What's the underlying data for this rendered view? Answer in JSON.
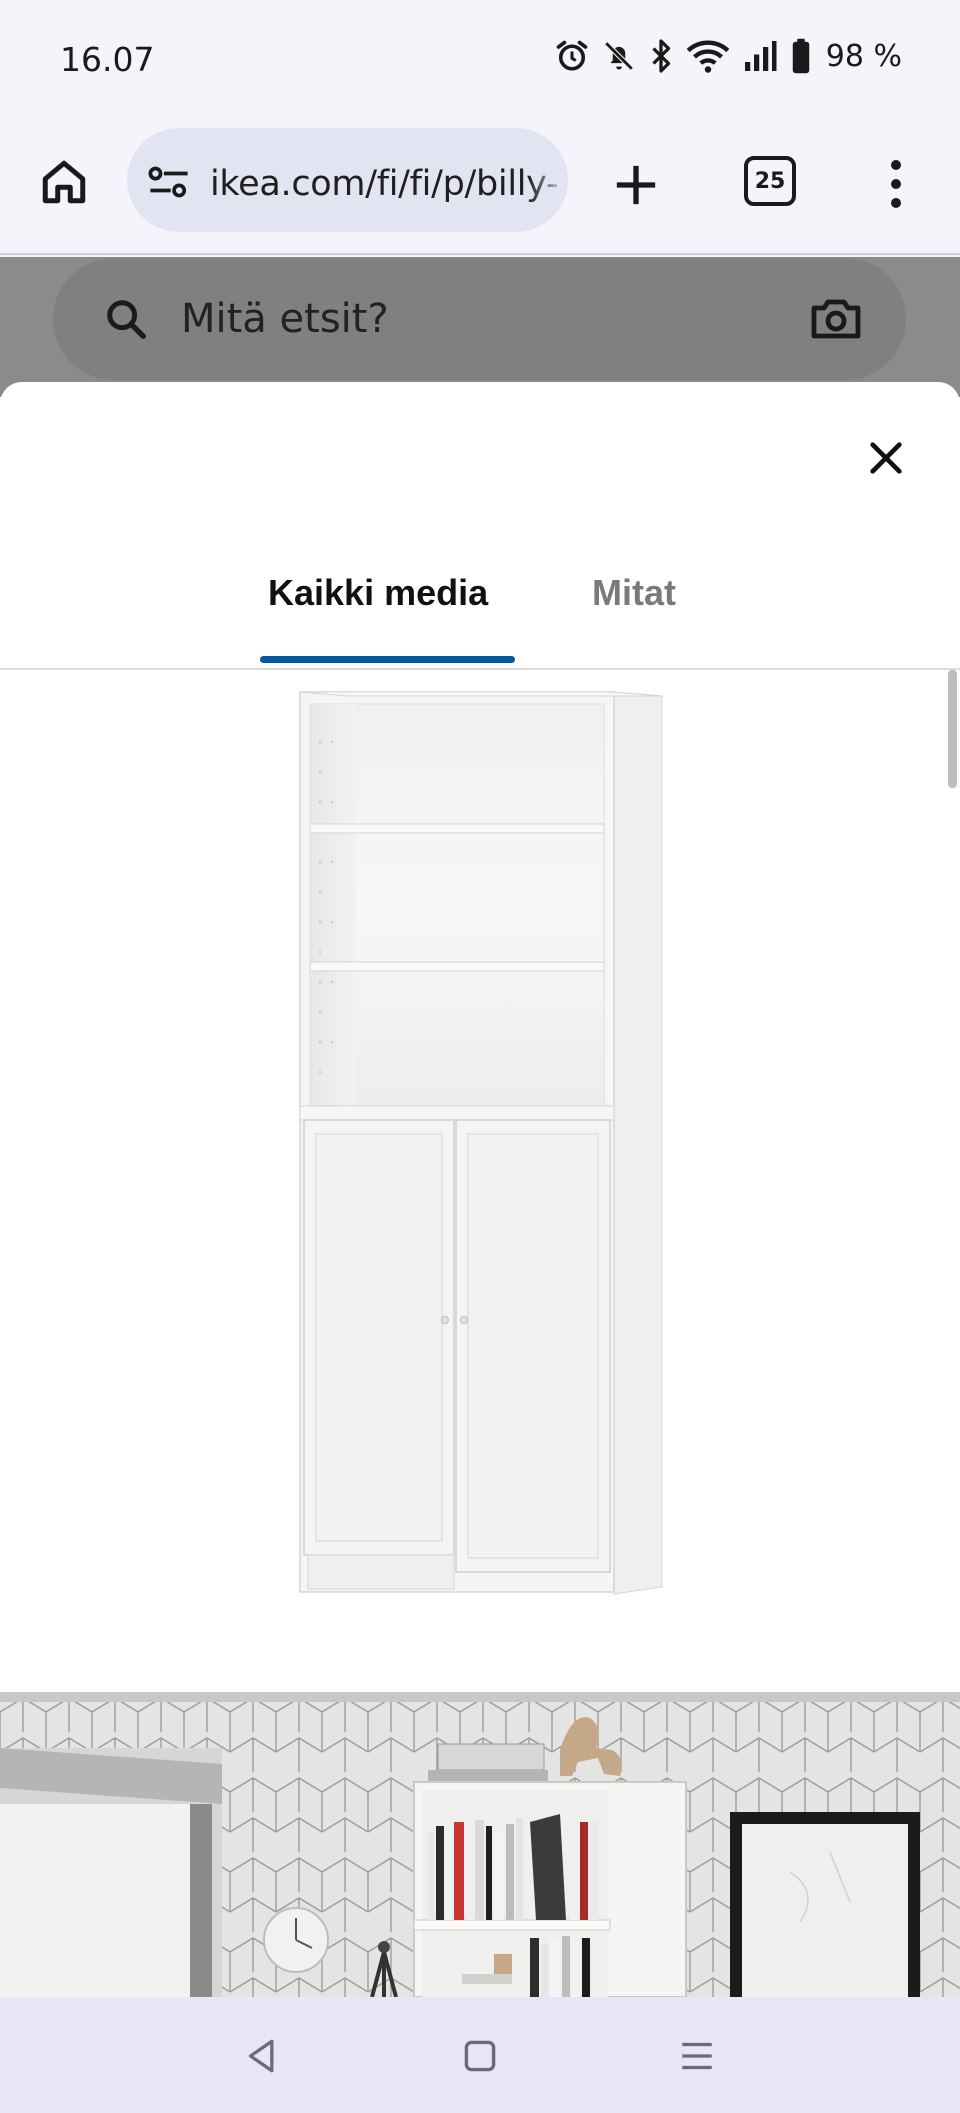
{
  "status_bar": {
    "time": "16.07",
    "battery": "98 %",
    "icons": [
      "alarm-icon",
      "bell-off-icon",
      "bluetooth-icon",
      "wifi-icon",
      "signal-icon",
      "battery-icon"
    ]
  },
  "browser": {
    "url": "ikea.com/fi/fi/p/billy-",
    "tab_count": "25",
    "icons": [
      "home-icon",
      "site-settings-icon",
      "plus-icon",
      "tabs-icon",
      "more-vert-icon"
    ]
  },
  "page_behind": {
    "search_placeholder": "Mitä etsit?",
    "icons": [
      "search-icon",
      "camera-icon"
    ]
  },
  "modal": {
    "tabs": [
      {
        "label": "Kaikki media",
        "selected": true
      },
      {
        "label": "Mitat",
        "selected": false
      }
    ],
    "close_icon": "close-icon",
    "accent_color": "#0058a3"
  },
  "nav_bar": {
    "icons": [
      "back-icon",
      "home-nav-icon",
      "recents-icon"
    ]
  }
}
